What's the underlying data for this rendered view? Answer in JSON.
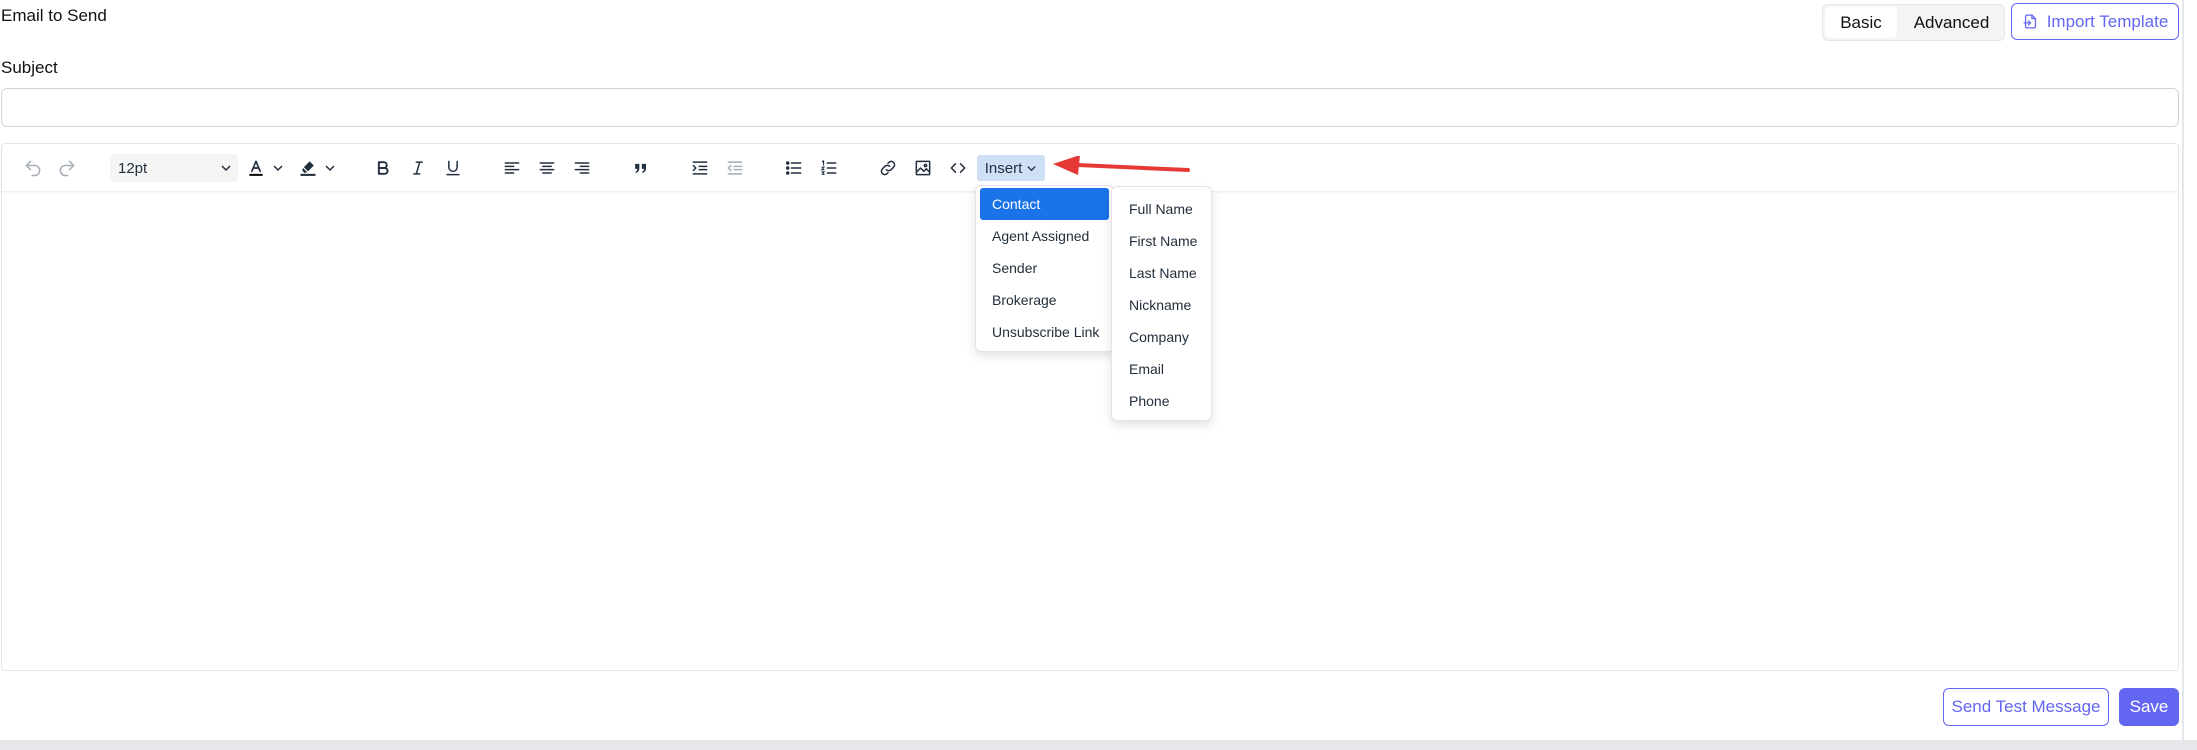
{
  "header": {
    "title": "Email to Send",
    "mode_basic": "Basic",
    "mode_advanced": "Advanced",
    "import_label": "Import Template"
  },
  "subject": {
    "label": "Subject",
    "value": "",
    "placeholder": ""
  },
  "toolbar": {
    "font_size": "12pt",
    "insert_label": "Insert",
    "icons": [
      "undo-icon",
      "redo-icon",
      "text-color-icon",
      "highlight-icon",
      "bold-icon",
      "italic-icon",
      "underline-icon",
      "align-left-icon",
      "align-center-icon",
      "align-right-icon",
      "blockquote-icon",
      "indent-icon",
      "outdent-icon",
      "bullet-list-icon",
      "numbered-list-icon",
      "link-icon",
      "image-icon",
      "code-icon"
    ]
  },
  "insert_menu": {
    "items": [
      "Contact",
      "Agent Assigned",
      "Sender",
      "Brokerage",
      "Unsubscribe Link"
    ],
    "active": "Contact"
  },
  "contact_submenu": {
    "items": [
      "Full Name",
      "First Name",
      "Last Name",
      "Nickname",
      "Company",
      "Email",
      "Phone"
    ]
  },
  "footer": {
    "test_label": "Send Test Message",
    "save_label": "Save"
  },
  "colors": {
    "accent": "#6366f1",
    "menu_active": "#1a73e8",
    "insert_button_bg": "#cfe0f6",
    "annotation_arrow": "#e53935"
  }
}
